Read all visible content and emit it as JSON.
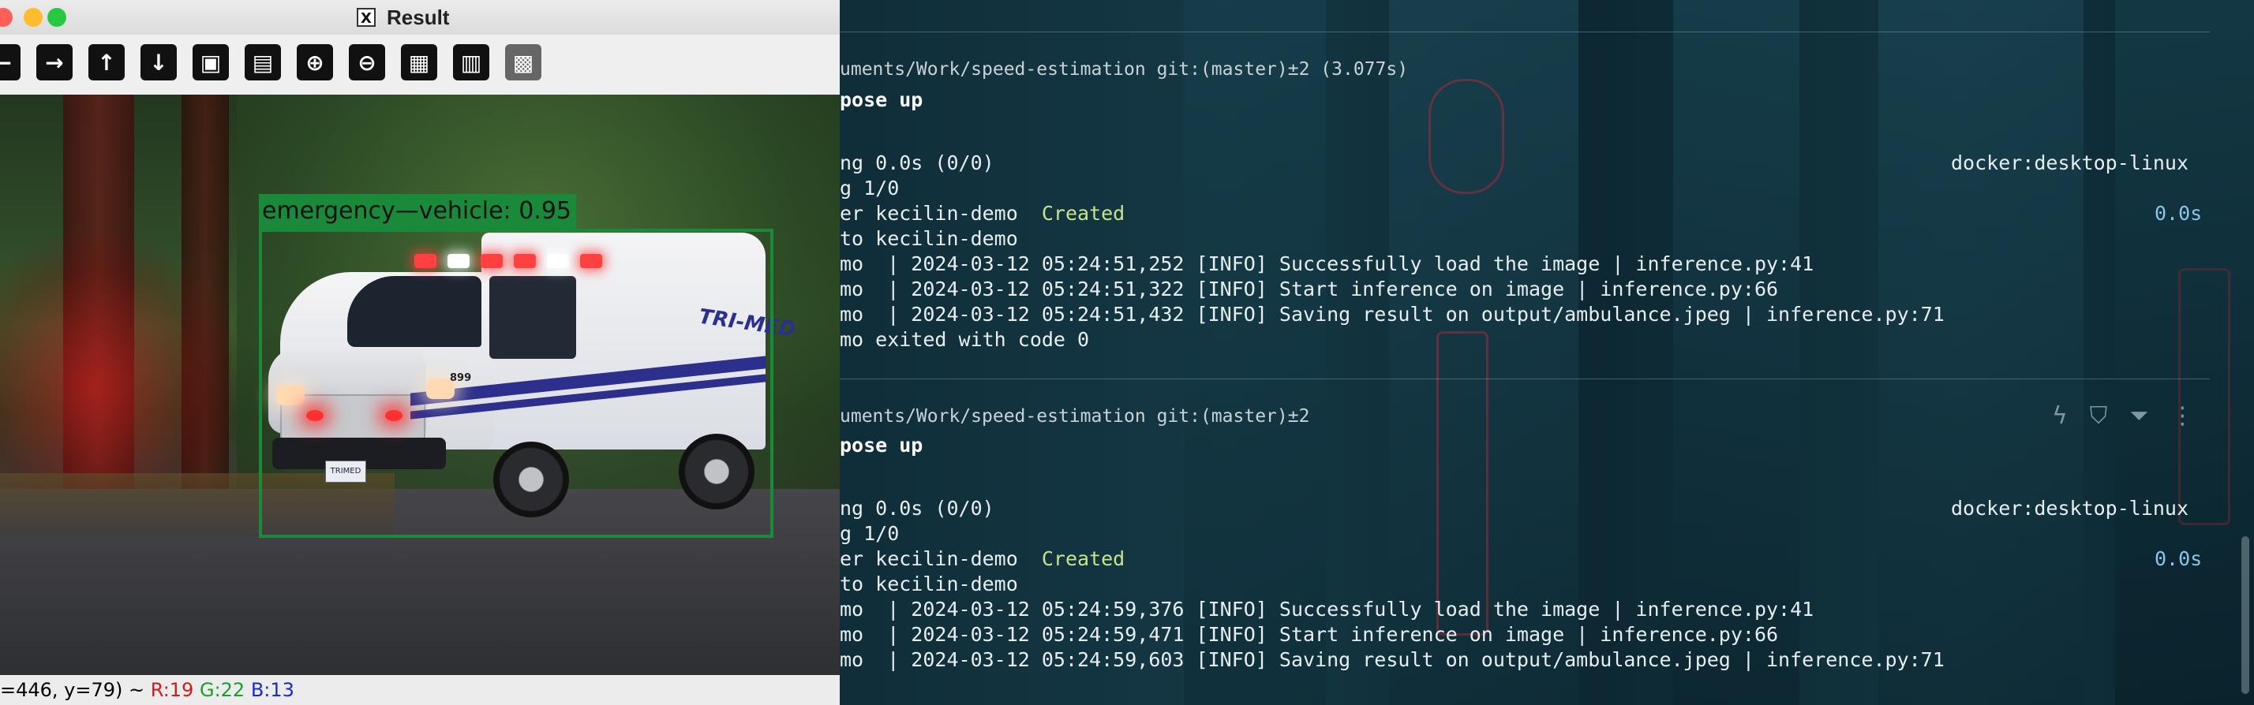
{
  "result_window": {
    "title": "Result",
    "app_icon_glyph": "X",
    "toolbar": [
      {
        "icon": "arrow-left-icon",
        "glyph": "←"
      },
      {
        "icon": "arrow-right-icon",
        "glyph": "→"
      },
      {
        "icon": "arrow-up-icon",
        "glyph": "↑"
      },
      {
        "icon": "arrow-down-icon",
        "glyph": "↓"
      },
      {
        "icon": "image-icon",
        "glyph": "▣"
      },
      {
        "icon": "image-settings-icon",
        "glyph": "▤"
      },
      {
        "icon": "zoom-in-icon",
        "glyph": "⊕"
      },
      {
        "icon": "zoom-out-icon",
        "glyph": "⊖"
      },
      {
        "icon": "save-icon",
        "glyph": "▦"
      },
      {
        "icon": "clipboard-icon",
        "glyph": "▥"
      },
      {
        "icon": "properties-icon",
        "glyph": "▩"
      }
    ],
    "detection_label": "emergency—vehicle: 0.95",
    "plate_text": "TRIMED",
    "vehicle_brand": "TRI-MED",
    "vehicle_unit": "899",
    "status": {
      "coords": "=446, y=79) ~ ",
      "r": "R:19",
      "g": "G:22",
      "b": "B:13"
    }
  },
  "terminal": {
    "block1": {
      "path": "uments/Work/speed-estimation git:(master)±2 (3.077s)",
      "cmd": "pose up",
      "l1": "ng 0.0s (0/0)",
      "l1_right": "docker:desktop-linux",
      "l2": "g 1/0",
      "l3": "er kecilin-demo  ",
      "l3_status": "Created",
      "l3_right": "0.0s",
      "l4": "to kecilin-demo",
      "l5": "mo  | 2024-03-12 05:24:51,252 [INFO] Successfully load the image | inference.py:41",
      "l6": "mo  | 2024-03-12 05:24:51,322 [INFO] Start inference on image | inference.py:66",
      "l7": "mo  | 2024-03-12 05:24:51,432 [INFO] Saving result on output/ambulance.jpeg | inference.py:71",
      "l8": "mo exited with code 0"
    },
    "block2": {
      "path": "uments/Work/speed-estimation git:(master)±2",
      "cmd": "pose up",
      "l1": "ng 0.0s (0/0)",
      "l1_right": "docker:desktop-linux",
      "l2": "g 1/0",
      "l3": "er kecilin-demo  ",
      "l3_status": "Created",
      "l3_right": "0.0s",
      "l4": "to kecilin-demo",
      "l5": "mo  | 2024-03-12 05:24:59,376 [INFO] Successfully load the image | inference.py:41",
      "l6": "mo  | 2024-03-12 05:24:59,471 [INFO] Start inference on image | inference.py:66",
      "l7": "mo  | 2024-03-12 05:24:59,603 [INFO] Saving result on output/ambulance.jpeg | inference.py:71"
    },
    "block_actions": [
      {
        "icon": "lightning-icon",
        "glyph": "ϟ"
      },
      {
        "icon": "bookmark-icon",
        "glyph": "⛉"
      },
      {
        "icon": "filter-icon",
        "glyph": "⏷"
      },
      {
        "icon": "more-vertical-icon",
        "glyph": "⋮"
      }
    ]
  },
  "colors": {
    "detection_box": "#1a8a3a",
    "status_r": "#d31a1a",
    "status_g": "#1aa02a",
    "status_b": "#1a2ad3",
    "created_status": "#c9e38c",
    "timing_right": "#8ec4e6"
  }
}
